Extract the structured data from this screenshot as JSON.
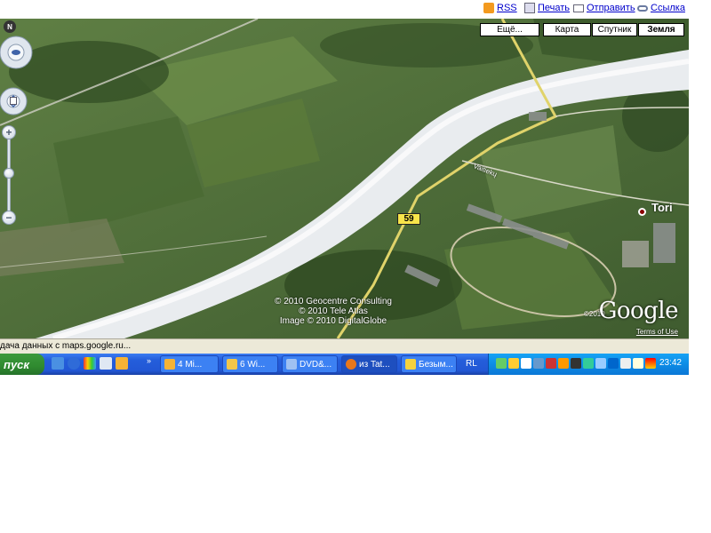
{
  "links": {
    "rss": "RSS",
    "print": "Печать",
    "send": "Отправить",
    "link": "Ссылка"
  },
  "map": {
    "types": {
      "more": "Ещё...",
      "map": "Карта",
      "satellite": "Спутник",
      "earth": "Земля"
    },
    "active_type": "Земля",
    "compass_north": "N",
    "route_number": "59",
    "street_label": "Vaitiekų",
    "place_name": "Tori",
    "copyright": [
      "© 2010 Geocentre Consulting",
      "© 2010 Tele Atlas",
      "Image © 2010 DigitalGlobe"
    ],
    "logo_year": "©2010",
    "logo": "Google",
    "terms": "Terms of Use",
    "zoom_in": "+",
    "zoom_out": "−"
  },
  "status": {
    "text": "дача данных с maps.google.ru..."
  },
  "taskbar": {
    "start": "пуск",
    "buttons": [
      {
        "label": "4 Mi...",
        "icon": "folder-icon",
        "color": "#f5b335"
      },
      {
        "label": "6 Wi...",
        "icon": "windows-folder-icon",
        "color": "#f3c649"
      },
      {
        "label": "DVD&...",
        "icon": "dvd-icon",
        "color": "#9fc1f2"
      },
      {
        "label": "из Tat...",
        "icon": "firefox-icon",
        "color": "#e8771b"
      },
      {
        "label": "Безым...",
        "icon": "paint-icon",
        "color": "#f5d23d"
      }
    ],
    "language": "RL",
    "clock": "23:42"
  }
}
